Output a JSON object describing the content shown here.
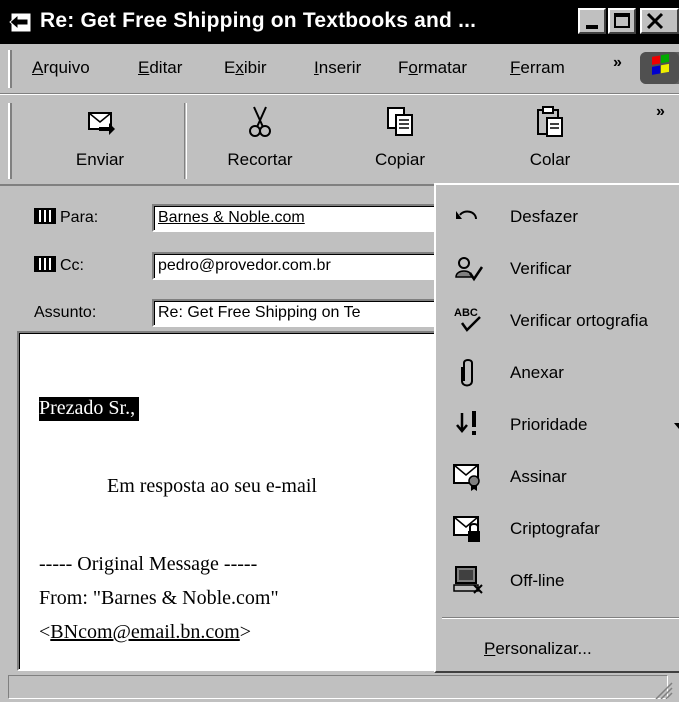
{
  "window": {
    "title": "Re: Get Free Shipping on Textbooks and ..."
  },
  "menubar": {
    "items": [
      {
        "label": "Arquivo"
      },
      {
        "label": "Editar"
      },
      {
        "label": "Exibir"
      },
      {
        "label": "Inserir"
      },
      {
        "label": "Formatar"
      },
      {
        "label": "Ferram"
      }
    ],
    "overflow": "»"
  },
  "toolbar": {
    "buttons": [
      {
        "label": "Enviar",
        "icon": "send-icon"
      },
      {
        "label": "Recortar",
        "icon": "scissors-icon"
      },
      {
        "label": "Copiar",
        "icon": "copy-icon"
      },
      {
        "label": "Colar",
        "icon": "paste-icon"
      }
    ],
    "overflow": "»"
  },
  "header": {
    "to_label": "Para:",
    "to_value": "Barnes & Noble.com",
    "cc_label": "Cc:",
    "cc_value": "pedro@provedor.com.br",
    "subject_label": "Assunto:",
    "subject_value": "Re: Get Free Shipping on Te"
  },
  "body": {
    "greeting": "Prezado Sr.,",
    "line1": "Em resposta ao seu e-mail",
    "line2": "----- Original Message -----",
    "line3": "From: \"Barnes & Noble.com\"",
    "line4_prefix": "<",
    "line4_link": "BNcom@email.bn.com",
    "line4_suffix": ">"
  },
  "dropdown": {
    "items": [
      {
        "label": "Desfazer",
        "icon": "undo-icon"
      },
      {
        "label": "Verificar",
        "icon": "check-names-icon"
      },
      {
        "label": "Verificar ortografia",
        "icon": "spellcheck-icon"
      },
      {
        "label": "Anexar",
        "icon": "paperclip-icon"
      },
      {
        "label": "Prioridade",
        "icon": "priority-icon",
        "submenu": true
      },
      {
        "label": "Assinar",
        "icon": "sign-icon"
      },
      {
        "label": "Criptografar",
        "icon": "encrypt-icon"
      },
      {
        "label": "Off-line",
        "icon": "offline-icon"
      }
    ],
    "customize": "Personalizar..."
  }
}
